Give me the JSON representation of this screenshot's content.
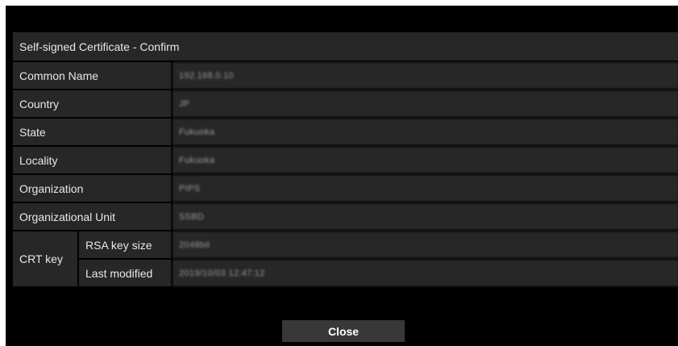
{
  "dialog": {
    "title": "Self-signed Certificate - Confirm",
    "close_label": "Close"
  },
  "fields": {
    "common_name": {
      "label": "Common Name",
      "value": "192.168.0.10"
    },
    "country": {
      "label": "Country",
      "value": "JP"
    },
    "state": {
      "label": "State",
      "value": "Fukuoka"
    },
    "locality": {
      "label": "Locality",
      "value": "Fukuoka"
    },
    "organization": {
      "label": "Organization",
      "value": "PIPS"
    },
    "org_unit": {
      "label": "Organizational Unit",
      "value": "SSBD"
    }
  },
  "crt_key": {
    "label": "CRT key",
    "rsa_key_size": {
      "label": "RSA key size",
      "value": "2048bit"
    },
    "last_modified": {
      "label": "Last modified",
      "value": "2019/10/03 12:47:12"
    }
  }
}
